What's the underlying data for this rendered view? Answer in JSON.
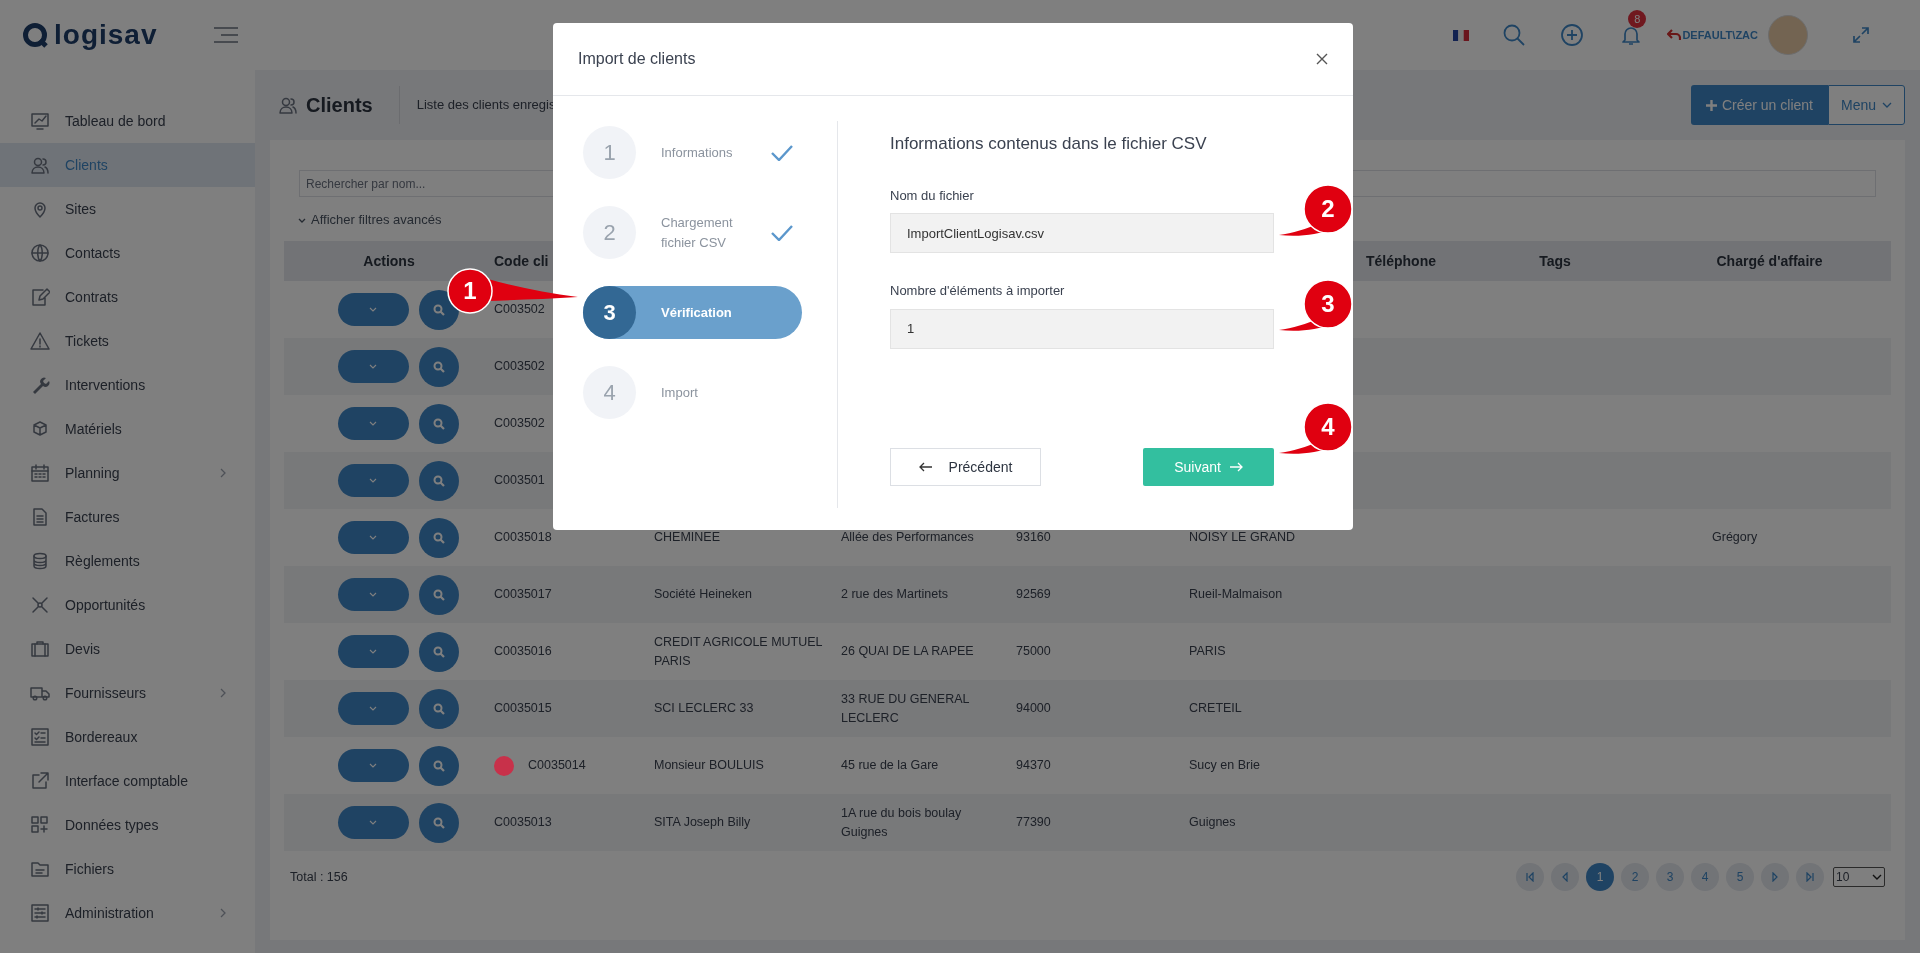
{
  "header": {
    "logo": "logisav",
    "notifications": "8",
    "user": "DEFAULT\\ZAC"
  },
  "sidebar": {
    "items": [
      {
        "label": "Tableau de bord",
        "selected": false,
        "expandable": false
      },
      {
        "label": "Clients",
        "selected": true,
        "expandable": false
      },
      {
        "label": "Sites",
        "selected": false,
        "expandable": false
      },
      {
        "label": "Contacts",
        "selected": false,
        "expandable": false
      },
      {
        "label": "Contrats",
        "selected": false,
        "expandable": false
      },
      {
        "label": "Tickets",
        "selected": false,
        "expandable": false
      },
      {
        "label": "Interventions",
        "selected": false,
        "expandable": false
      },
      {
        "label": "Matériels",
        "selected": false,
        "expandable": false
      },
      {
        "label": "Planning",
        "selected": false,
        "expandable": true
      },
      {
        "label": "Factures",
        "selected": false,
        "expandable": false
      },
      {
        "label": "Règlements",
        "selected": false,
        "expandable": false
      },
      {
        "label": "Opportunités",
        "selected": false,
        "expandable": false
      },
      {
        "label": "Devis",
        "selected": false,
        "expandable": false
      },
      {
        "label": "Fournisseurs",
        "selected": false,
        "expandable": true
      },
      {
        "label": "Bordereaux",
        "selected": false,
        "expandable": false
      },
      {
        "label": "Interface comptable",
        "selected": false,
        "expandable": false
      },
      {
        "label": "Données types",
        "selected": false,
        "expandable": false
      },
      {
        "label": "Fichiers",
        "selected": false,
        "expandable": false
      },
      {
        "label": "Administration",
        "selected": false,
        "expandable": true
      }
    ]
  },
  "page": {
    "title": "Clients",
    "subtitle": "Liste des clients enregis",
    "create_button": "Créer un client",
    "menu_button": "Menu"
  },
  "search": {
    "placeholder": "Rechercher par nom..."
  },
  "filters_toggle": "Afficher filtres avancés",
  "table": {
    "header_left": [
      "Actions",
      "Code cli"
    ],
    "header_right": [
      "Téléphone",
      "Tags",
      "Chargé d'affaire"
    ],
    "rows": [
      {
        "cells": [
          "C003502"
        ]
      },
      {
        "cells": [
          "C003502"
        ]
      },
      {
        "cells": [
          "C003502"
        ]
      },
      {
        "cells": [
          "C003501"
        ]
      },
      {
        "cells": [
          "C0035018",
          "CHEMINEE",
          "Allée des Performances",
          "93160",
          "NOISY LE GRAND",
          "",
          "",
          "Grégory"
        ]
      },
      {
        "cells": [
          "C0035017",
          "Société Heineken",
          "2 rue des Martinets",
          "92569",
          "Rueil-Malmaison"
        ]
      },
      {
        "cells": [
          "C0035016",
          "CREDIT AGRICOLE MUTUEL PARIS",
          "26 QUAI DE LA RAPEE",
          "75000",
          "PARIS"
        ]
      },
      {
        "cells": [
          "C0035015",
          "SCI LECLERC 33",
          "33 RUE DU GENERAL LECLERC",
          "94000",
          "CRETEIL"
        ]
      },
      {
        "cells": [
          "C0035014",
          "Monsieur BOULUIS",
          "45 rue de la Gare",
          "94370",
          "Sucy en Brie"
        ],
        "color": "#c8314a"
      },
      {
        "cells": [
          "C0035013",
          "SITA Joseph Billy",
          "1A rue du bois boulay Guignes",
          "77390",
          "Guignes"
        ]
      }
    ]
  },
  "total": "Total : 156",
  "pagination": {
    "pages": [
      {
        "label": "1",
        "selected": true
      },
      {
        "label": "2",
        "selected": false
      },
      {
        "label": "3",
        "selected": false
      },
      {
        "label": "4",
        "selected": false
      },
      {
        "label": "5",
        "selected": false
      }
    ],
    "page_size": "10"
  },
  "modal": {
    "title": "Import de clients",
    "steps": [
      {
        "number": "1",
        "label": "Informations",
        "done": true,
        "selected": false
      },
      {
        "number": "2",
        "label": "Chargement fichier CSV",
        "done": true,
        "selected": false
      },
      {
        "number": "3",
        "label": "Vérification",
        "done": false,
        "selected": true
      },
      {
        "number": "4",
        "label": "Import",
        "done": false,
        "selected": false
      }
    ],
    "heading": "Informations contenus dans le fichier CSV",
    "fields": [
      {
        "label": "Nom du fichier",
        "value": "ImportClientLogisav.csv"
      },
      {
        "label": "Nombre d'éléments à importer",
        "value": "1"
      }
    ],
    "back_button": "Précédent",
    "next_button": "Suivant"
  },
  "callouts": [
    {
      "number": "1"
    },
    {
      "number": "2"
    },
    {
      "number": "3"
    },
    {
      "number": "4"
    }
  ]
}
